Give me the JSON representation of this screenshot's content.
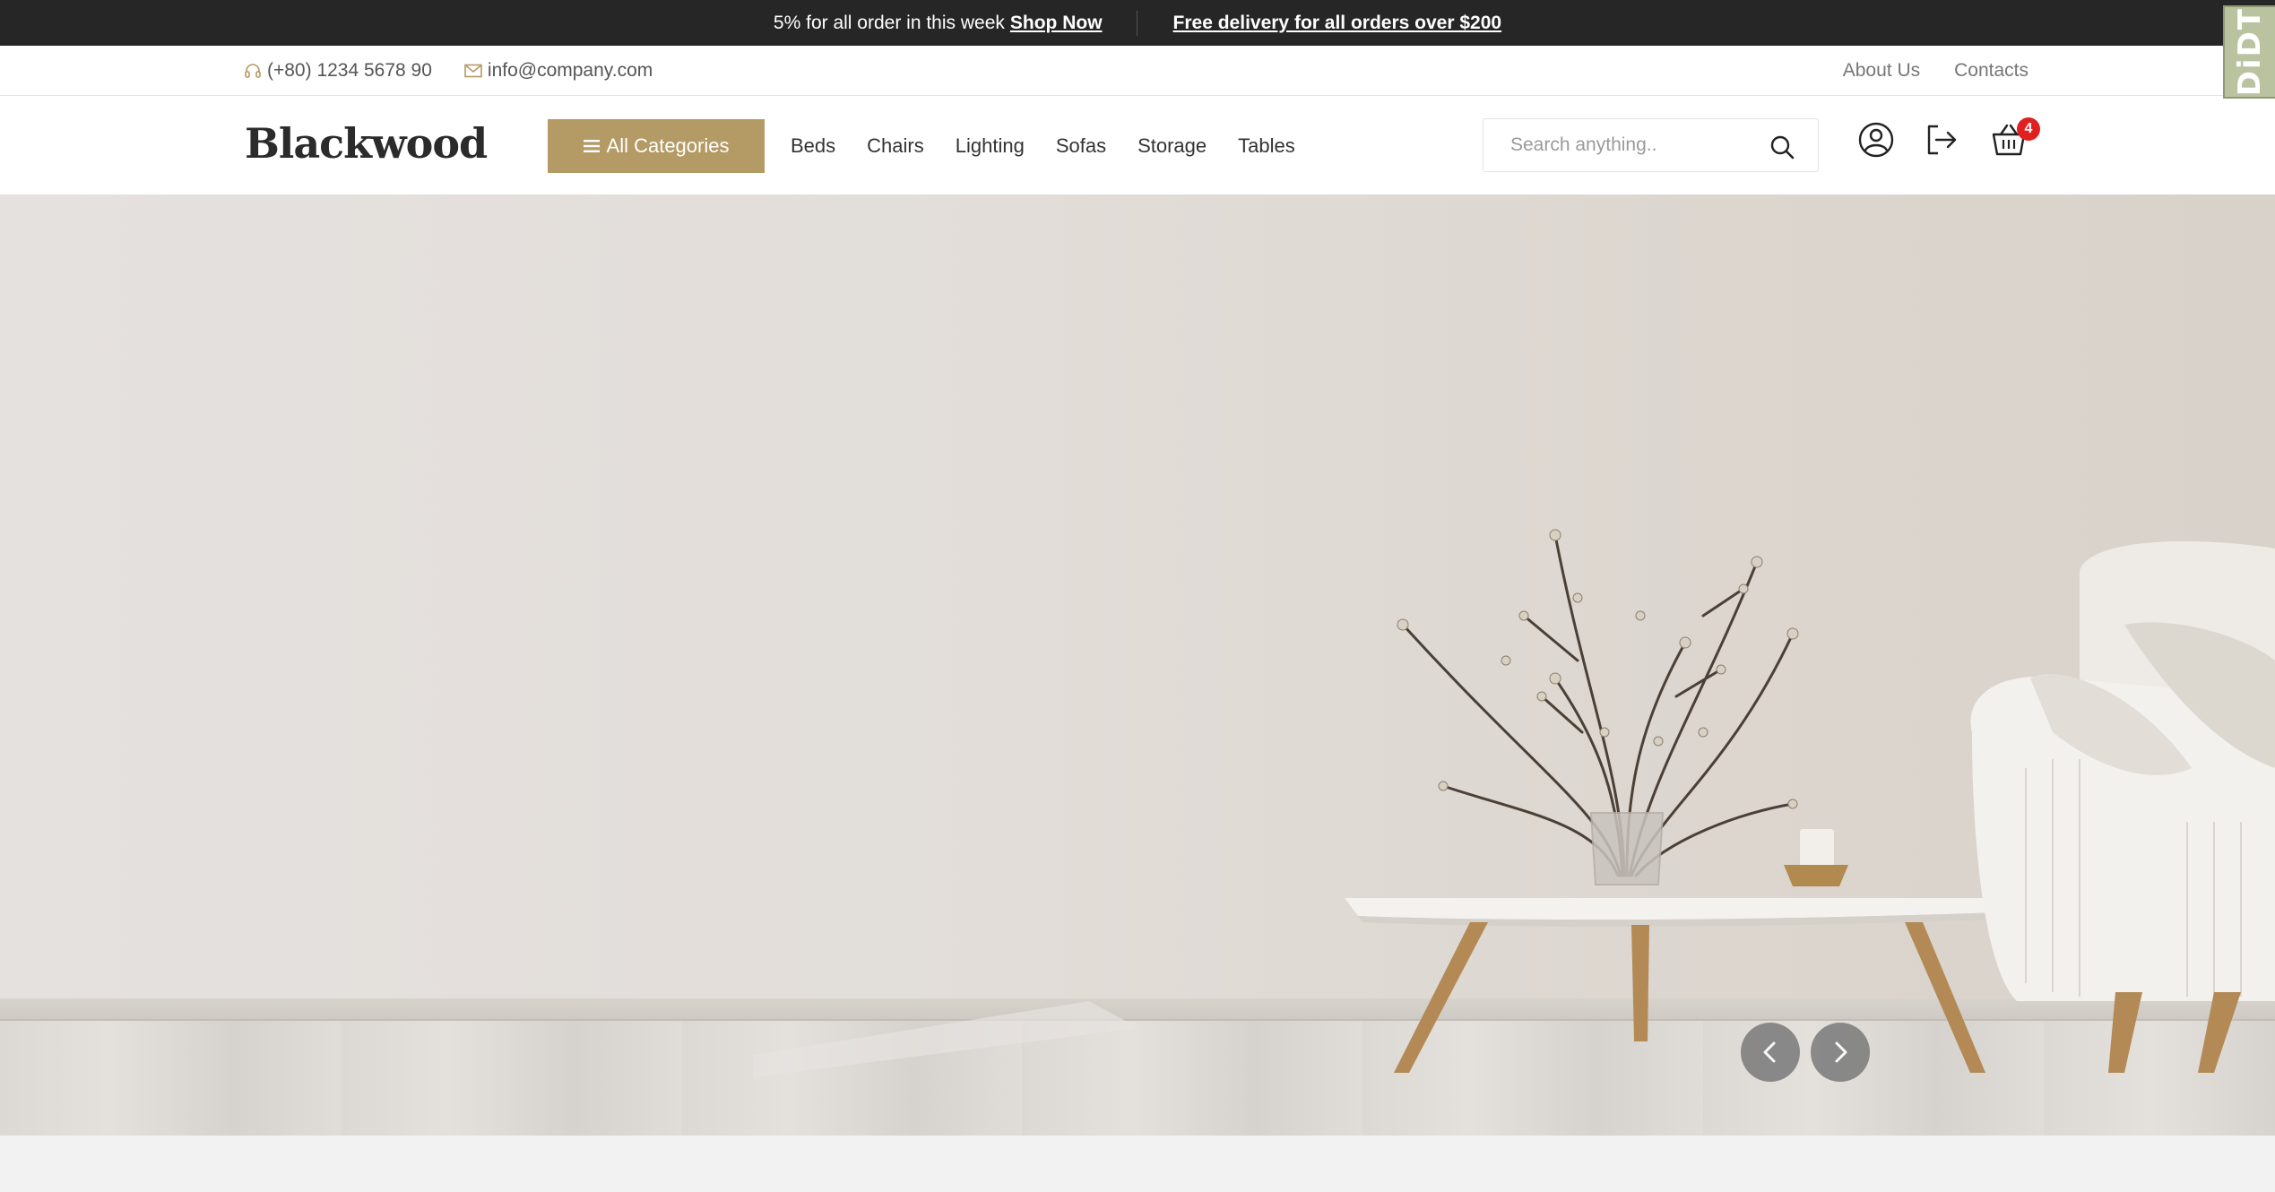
{
  "promo": {
    "text": "5% for all order in this week",
    "link": "Shop Now",
    "delivery": "Free delivery for all orders over $200"
  },
  "info": {
    "phone_icon": "headset-icon",
    "phone": "(+80) 1234 5678 90",
    "email_icon": "envelope-icon",
    "email": "info@company.com",
    "links": [
      "About Us",
      "Contacts"
    ]
  },
  "header": {
    "logo": "Blackwood",
    "all_categories": "All Categories",
    "nav": [
      "Beds",
      "Chairs",
      "Lighting",
      "Sofas",
      "Storage",
      "Tables"
    ],
    "search_placeholder": "Search anything..",
    "cart_count": "4",
    "icons": [
      "user-icon",
      "logout-icon",
      "basket-icon"
    ]
  },
  "hero": {
    "prev_icon": "chevron-left-icon",
    "next_icon": "chevron-right-icon"
  },
  "widget": {
    "label": "DiDT"
  },
  "colors": {
    "accent": "#b49a64",
    "top_bar": "#262626",
    "badge": "#e02020"
  }
}
